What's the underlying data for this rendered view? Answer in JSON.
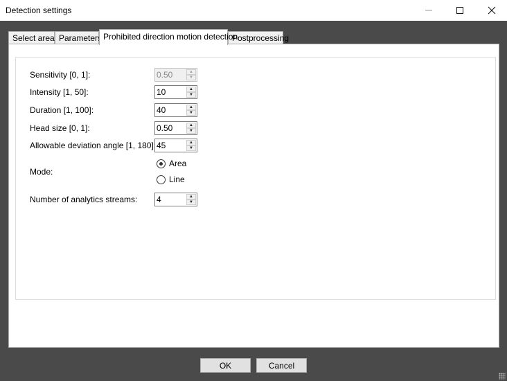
{
  "window": {
    "title": "Detection settings"
  },
  "tabs": [
    {
      "label": "Select area"
    },
    {
      "label": "Parameters"
    },
    {
      "label": "Prohibited direction motion detection"
    },
    {
      "label": "Postprocessing"
    }
  ],
  "active_tab": 2,
  "fields": {
    "sensitivity": {
      "label": "Sensitivity [0, 1]:",
      "value": "0.50",
      "enabled": false
    },
    "intensity": {
      "label": "Intensity [1, 50]:",
      "value": "10"
    },
    "duration": {
      "label": "Duration [1, 100]:",
      "value": "40"
    },
    "head_size": {
      "label": "Head size [0, 1]:",
      "value": "0.50"
    },
    "deviation": {
      "label": "Allowable deviation angle [1, 180]:",
      "value": "45"
    },
    "streams": {
      "label": "Number of analytics streams:",
      "value": "4"
    }
  },
  "mode": {
    "label": "Mode:",
    "options": [
      {
        "label": "Area",
        "checked": true
      },
      {
        "label": "Line",
        "checked": false
      }
    ]
  },
  "buttons": {
    "ok": "OK",
    "cancel": "Cancel"
  }
}
